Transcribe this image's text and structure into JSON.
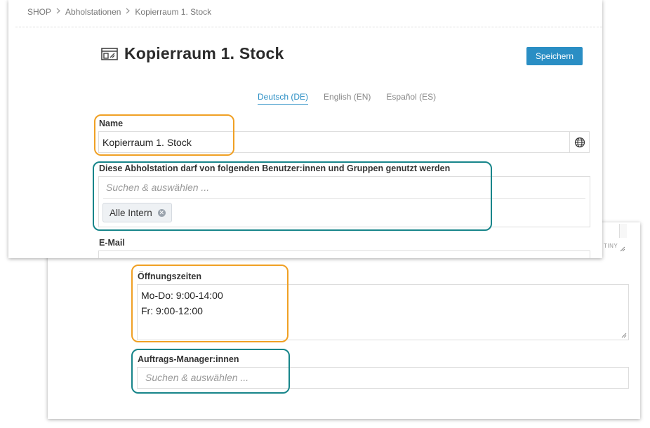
{
  "breadcrumb": {
    "items": [
      "SHOP",
      "Abholstationen",
      "Kopierraum 1. Stock"
    ]
  },
  "page": {
    "title": "Kopierraum 1. Stock",
    "save_label": "Speichern"
  },
  "languages": [
    {
      "label": "Deutsch (DE)",
      "active": true
    },
    {
      "label": "English (EN)",
      "active": false
    },
    {
      "label": "Español (ES)",
      "active": false
    }
  ],
  "form": {
    "name": {
      "label": "Name",
      "value": "Kopierraum 1. Stock"
    },
    "users": {
      "label": "Diese Abholstation darf von folgenden Benutzer:innen und Gruppen genutzt werden",
      "placeholder": "Suchen & auswählen ...",
      "selected": [
        "Alle Intern"
      ]
    },
    "email": {
      "label": "E-Mail"
    },
    "opening_hours": {
      "label": "Öffnungszeiten",
      "lines": [
        "Mo-Do: 9:00-14:00",
        "Fr: 9:00-12:00"
      ]
    },
    "order_managers": {
      "label": "Auftrags-Manager:innen",
      "placeholder": "Suchen & auswählen ..."
    }
  },
  "editor_fragment": "TINY",
  "colors": {
    "accent": "#2a8ec4",
    "highlight_orange": "#f0a024",
    "highlight_teal": "#17858a"
  },
  "icons": [
    "pickup-station-icon",
    "chevron-right-icon",
    "globe-icon",
    "tag-remove-icon",
    "resize-handle-icon"
  ]
}
